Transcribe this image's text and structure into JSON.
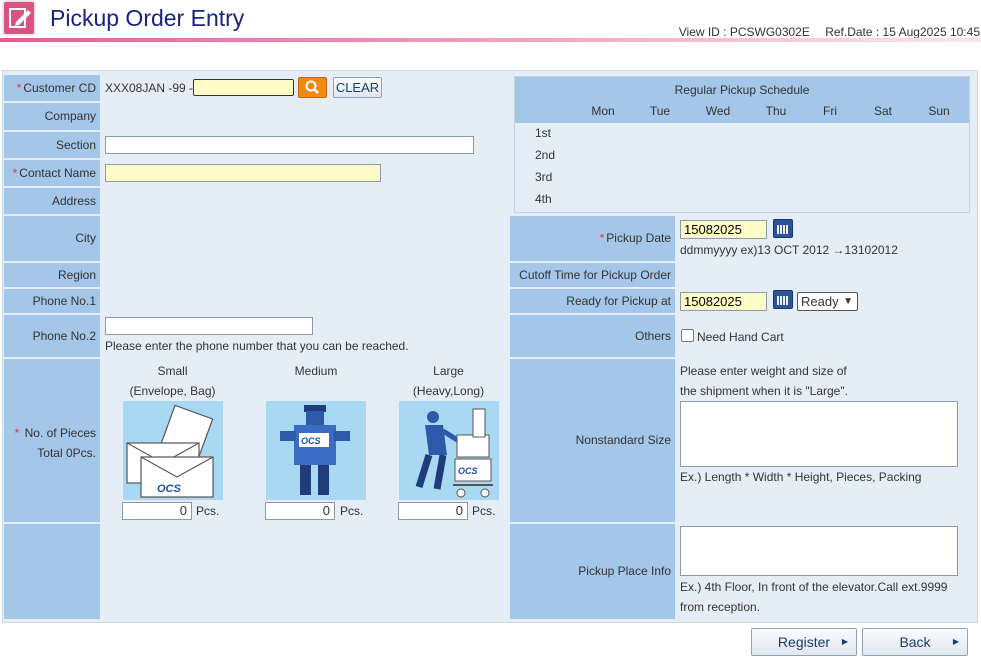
{
  "header": {
    "title": "Pickup Order Entry",
    "view_id": "View ID : PCSWG0302E",
    "ref_date": "Ref.Date : 15 Aug2025 10:45"
  },
  "form": {
    "customer_cd": {
      "label": "Customer CD",
      "prefix": "XXX08JAN -99 -",
      "value": "",
      "clear_label": "CLEAR"
    },
    "company": {
      "label": "Company"
    },
    "section": {
      "label": "Section",
      "value": ""
    },
    "contact_name": {
      "label": "Contact Name",
      "value": ""
    },
    "address": {
      "label": "Address"
    },
    "city": {
      "label": "City"
    },
    "region": {
      "label": "Region"
    },
    "phone1": {
      "label": "Phone No.1"
    },
    "phone2": {
      "label": "Phone No.2",
      "value": "",
      "hint": "Please enter the phone number that you can be reached."
    },
    "pieces": {
      "label": "No. of Pieces",
      "total": "Total 0Pcs.",
      "small": {
        "title": "Small",
        "sub": "(Envelope, Bag)",
        "value": "0"
      },
      "medium": {
        "title": "Medium",
        "sub": "",
        "value": "0"
      },
      "large": {
        "title": "Large",
        "sub": "(Heavy,Long)",
        "value": "0"
      },
      "unit": "Pcs."
    }
  },
  "schedule": {
    "title": "Regular Pickup Schedule",
    "days": [
      "Mon",
      "Tue",
      "Wed",
      "Thu",
      "Fri",
      "Sat",
      "Sun"
    ],
    "weeks": [
      "1st",
      "2nd",
      "3rd",
      "4th"
    ]
  },
  "pickup": {
    "date": {
      "label": "Pickup Date",
      "value": "15082025",
      "hint": "ddmmyyyy ex)13 OCT 2012 →13102012"
    },
    "cutoff": {
      "label": "Cutoff Time for Pickup Order"
    },
    "ready": {
      "label": "Ready for Pickup at",
      "value": "15082025",
      "select": "Ready"
    },
    "others": {
      "label": "Others",
      "checkbox_label": "Need Hand Cart"
    },
    "nonstandard": {
      "label": "Nonstandard Size",
      "hint1": "Please enter weight and size of",
      "hint2": "the shipment when it is \"Large\".",
      "example": "Ex.) Length * Width * Height, Pieces, Packing"
    },
    "place": {
      "label": "Pickup Place Info",
      "example1": "Ex.) 4th Floor, In front of the elevator.Call ext.9999",
      "example2": "from reception."
    }
  },
  "actions": {
    "register": "Register",
    "back": "Back"
  },
  "brand": {
    "logo": "OCS",
    "accent": "#e75a93",
    "label_bg": "#a4c6e8",
    "field_bg": "#e5eef7",
    "required": "#e0383e"
  }
}
